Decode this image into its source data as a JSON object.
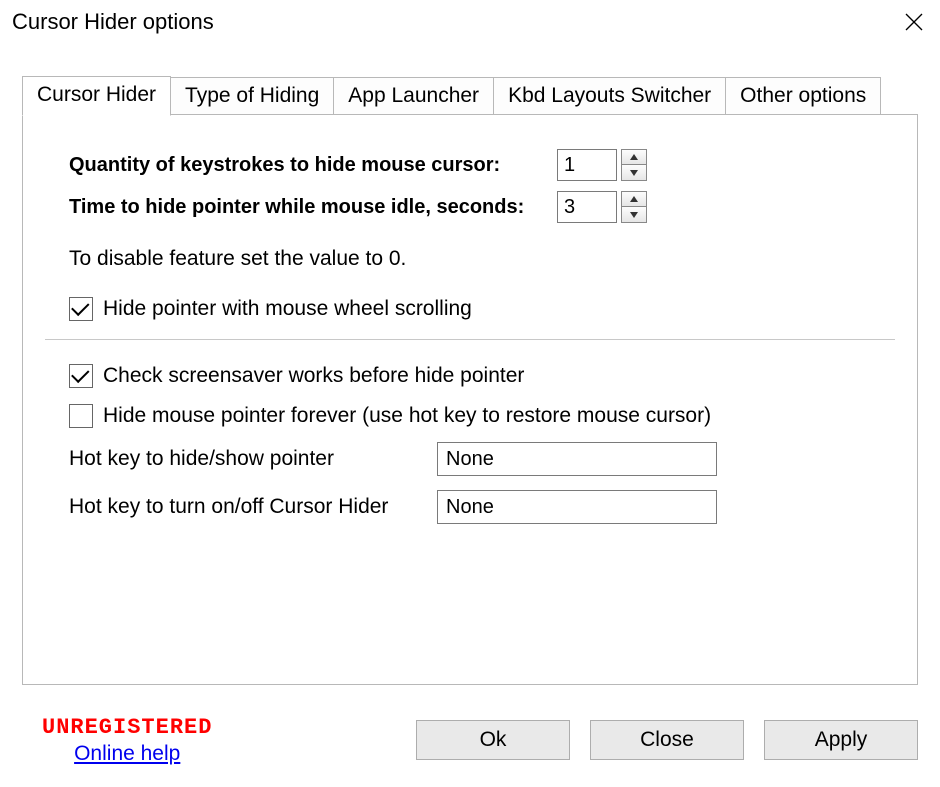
{
  "window": {
    "title": "Cursor Hider options"
  },
  "tabs": [
    {
      "label": "Cursor Hider",
      "active": true
    },
    {
      "label": "Type of Hiding",
      "active": false
    },
    {
      "label": "App Launcher",
      "active": false
    },
    {
      "label": "Kbd Layouts Switcher",
      "active": false
    },
    {
      "label": "Other options",
      "active": false
    }
  ],
  "panel": {
    "keystrokes_label": "Quantity of keystrokes to hide mouse cursor:",
    "keystrokes_value": "1",
    "idle_label": "Time to hide pointer while mouse idle, seconds:",
    "idle_value": "3",
    "disable_hint": "To disable feature set the value to 0.",
    "hide_with_wheel": {
      "label": "Hide pointer with mouse wheel scrolling",
      "checked": true
    },
    "check_screensaver": {
      "label": "Check screensaver works before hide pointer",
      "checked": true
    },
    "hide_forever": {
      "label": "Hide mouse pointer forever (use hot key to restore mouse cursor)",
      "checked": false
    },
    "hotkey_hideshow": {
      "label": "Hot key to hide/show pointer",
      "value": "None"
    },
    "hotkey_onoff": {
      "label": "Hot key to turn on/off Cursor Hider",
      "value": "None"
    }
  },
  "footer": {
    "unregistered": "UNREGISTERED",
    "help_link": "Online help",
    "ok": "Ok",
    "close": "Close",
    "apply": "Apply"
  }
}
